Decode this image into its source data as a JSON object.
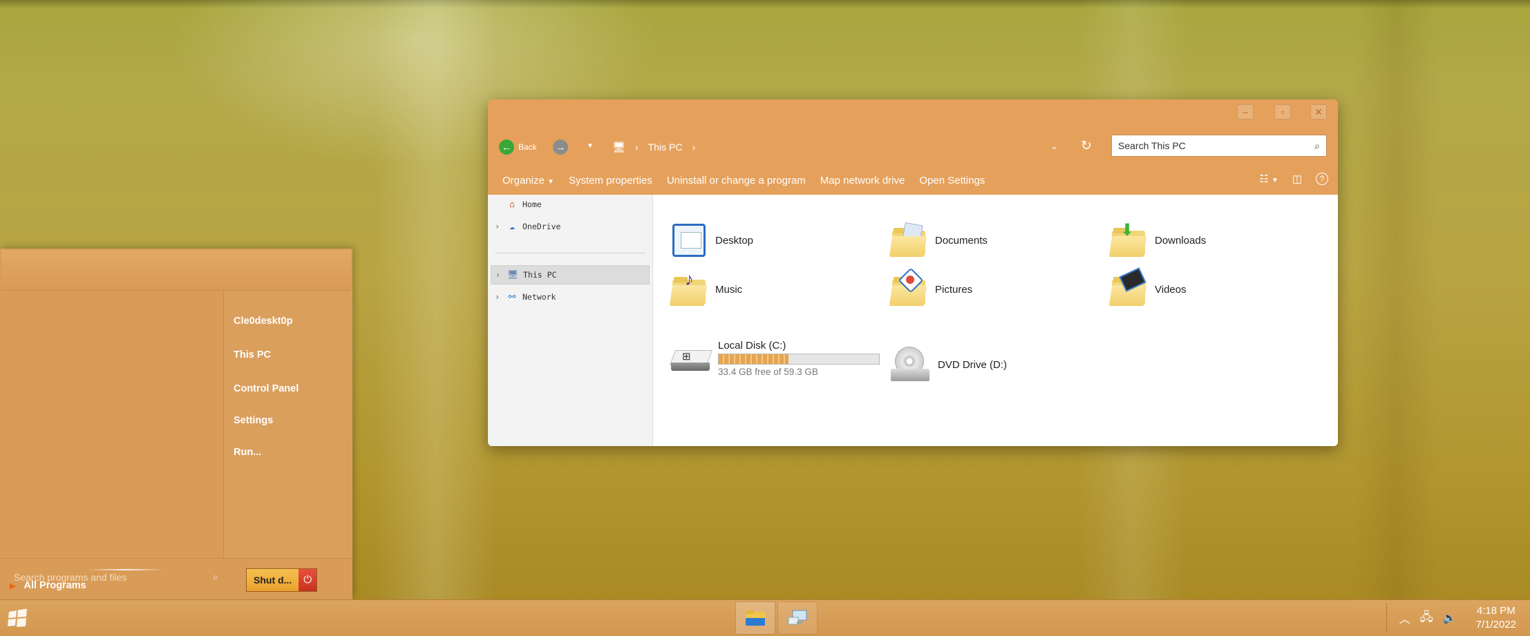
{
  "window": {
    "nav": {
      "back_label": "Back",
      "breadcrumb": "This PC",
      "search_placeholder": "Search This PC"
    },
    "toolbar": {
      "items": [
        "Organize",
        "System properties",
        "Uninstall or change a program",
        "Map network drive",
        "Open Settings"
      ]
    },
    "nav_pane": {
      "home": "Home",
      "onedrive": "OneDrive",
      "this_pc": "This PC",
      "network": "Network"
    },
    "folders": [
      {
        "label": "Desktop"
      },
      {
        "label": "Documents"
      },
      {
        "label": "Downloads"
      },
      {
        "label": "Music"
      },
      {
        "label": "Pictures"
      },
      {
        "label": "Videos"
      }
    ],
    "drives": {
      "c": {
        "label": "Local Disk (C:)",
        "free": "33.4 GB free of 59.3 GB",
        "used_fraction": 0.437
      },
      "d": {
        "label": "DVD Drive (D:)"
      }
    }
  },
  "start_menu": {
    "right_items": [
      "Cle0deskt0p",
      "This PC",
      "Control Panel",
      "Settings",
      "Run..."
    ],
    "all_programs": "All Programs",
    "search_placeholder": "Search programs and files",
    "shutdown_label": "Shut d..."
  },
  "taskbar": {
    "time": "4:18 PM",
    "date": "7/1/2022"
  },
  "colors": {
    "accent": "#e39f57",
    "taskbar": "#d89c56",
    "shutdown": "#f2b23f",
    "power": "#d9402b"
  }
}
